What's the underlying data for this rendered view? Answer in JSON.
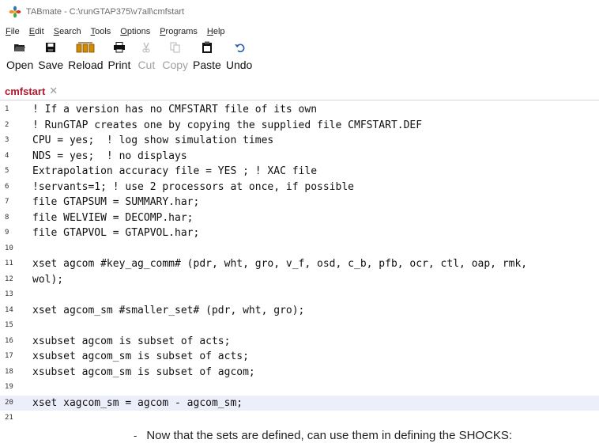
{
  "window": {
    "title": "TABmate - C:\\runGTAP375\\v7all\\cmfstart"
  },
  "menu": [
    {
      "pre": "",
      "key": "F",
      "post": "ile"
    },
    {
      "pre": "",
      "key": "E",
      "post": "dit"
    },
    {
      "pre": "",
      "key": "S",
      "post": "earch"
    },
    {
      "pre": "",
      "key": "T",
      "post": "ools"
    },
    {
      "pre": "",
      "key": "O",
      "post": "ptions"
    },
    {
      "pre": "",
      "key": "P",
      "post": "rograms"
    },
    {
      "pre": "",
      "key": "H",
      "post": "elp"
    }
  ],
  "toolbar": [
    {
      "label": "Open",
      "icon": "open-folder-icon",
      "enabled": true
    },
    {
      "label": "Save",
      "icon": "floppy-disk-icon",
      "enabled": true
    },
    {
      "label": "Reload",
      "icon": "reload-icon",
      "enabled": true
    },
    {
      "label": "Print",
      "icon": "printer-icon",
      "enabled": true
    },
    {
      "label": "Cut",
      "icon": "scissors-icon",
      "enabled": false
    },
    {
      "label": "Copy",
      "icon": "copy-icon",
      "enabled": false
    },
    {
      "label": "Paste",
      "icon": "clipboard-icon",
      "enabled": true
    },
    {
      "label": "Undo",
      "icon": "undo-icon",
      "enabled": true
    }
  ],
  "tabs": [
    {
      "label": "cmfstart",
      "close": "✕"
    }
  ],
  "editor": {
    "current_line": 20,
    "lines": [
      {
        "n": "1",
        "text": "! If a version has no CMFSTART file of its own"
      },
      {
        "n": "2",
        "text": "! RunGTAP creates one by copying the supplied file CMFSTART.DEF"
      },
      {
        "n": "3",
        "text": "CPU = yes;  ! log show simulation times"
      },
      {
        "n": "4",
        "text": "NDS = yes;  ! no displays"
      },
      {
        "n": "5",
        "text": "Extrapolation accuracy file = YES ; ! XAC file"
      },
      {
        "n": "6",
        "text": "!servants=1; ! use 2 processors at once, if possible"
      },
      {
        "n": "7",
        "text": "file GTAPSUM = SUMMARY.har;"
      },
      {
        "n": "8",
        "text": "file WELVIEW = DECOMP.har;"
      },
      {
        "n": "9",
        "text": "file GTAPVOL = GTAPVOL.har;"
      },
      {
        "n": "10",
        "text": ""
      },
      {
        "n": "11",
        "text": "xset agcom #key_ag_comm# (pdr, wht, gro, v_f, osd, c_b, pfb, ocr, ctl, oap, rmk,"
      },
      {
        "n": "12",
        "text": "wol);"
      },
      {
        "n": "13",
        "text": ""
      },
      {
        "n": "14",
        "text": "xset agcom_sm #smaller_set# (pdr, wht, gro);"
      },
      {
        "n": "15",
        "text": ""
      },
      {
        "n": "16",
        "text": "xsubset agcom is subset of acts;"
      },
      {
        "n": "17",
        "text": "xsubset agcom_sm is subset of acts;"
      },
      {
        "n": "18",
        "text": "xsubset agcom_sm is subset of agcom;"
      },
      {
        "n": "19",
        "text": ""
      },
      {
        "n": "20",
        "text": "xset xagcom_sm = agcom - agcom_sm;"
      },
      {
        "n": "21",
        "text": ""
      }
    ]
  },
  "caption": {
    "bullet": "-",
    "text": "Now that the sets are defined, can use them in defining the SHOCKS:"
  }
}
